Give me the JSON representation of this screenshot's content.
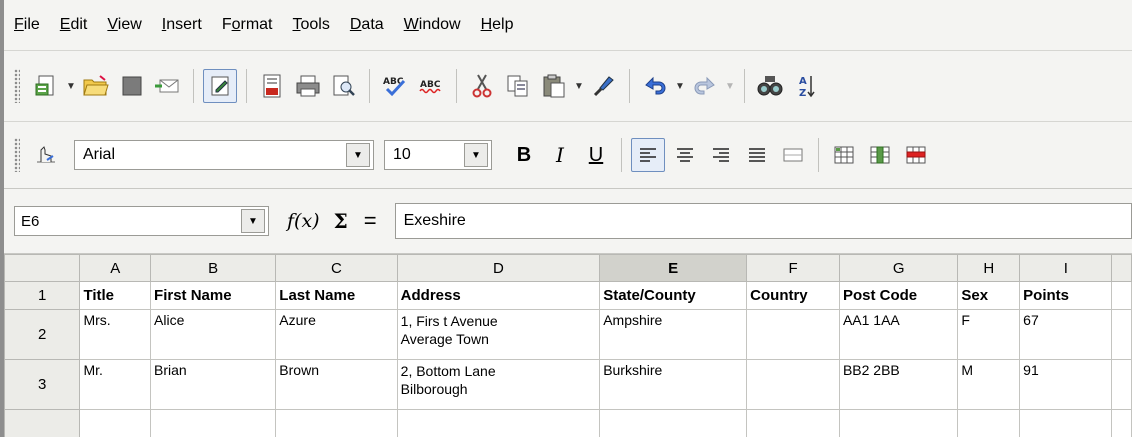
{
  "menu": [
    {
      "underline": "F",
      "rest": "ile"
    },
    {
      "underline": "E",
      "rest": "dit"
    },
    {
      "underline": "V",
      "rest": "iew"
    },
    {
      "underline": "I",
      "rest": "nsert"
    },
    {
      "pre": "F",
      "underline": "o",
      "rest": "rmat"
    },
    {
      "underline": "T",
      "rest": "ools"
    },
    {
      "underline": "D",
      "rest": "ata"
    },
    {
      "underline": "W",
      "rest": "indow"
    },
    {
      "underline": "H",
      "rest": "elp"
    }
  ],
  "format_bar": {
    "font_name": "Arial",
    "font_size": "10",
    "bold_label": "B",
    "italic_label": "I",
    "underline_label": "U"
  },
  "formula_bar": {
    "cell_ref": "E6",
    "fx_label": "f(x)",
    "sigma_label": "Σ",
    "equals_label": "=",
    "content": "Exeshire"
  },
  "sheet": {
    "columns": [
      "A",
      "B",
      "C",
      "D",
      "E",
      "F",
      "G",
      "H",
      "I"
    ],
    "active_column": "E",
    "rows": [
      {
        "num": "1",
        "cells": [
          "Title",
          "First Name",
          "Last Name",
          "Address",
          "State/County",
          "Country",
          "Post Code",
          "Sex",
          "Points"
        ]
      },
      {
        "num": "2",
        "cells": [
          "Mrs.",
          "Alice",
          "Azure",
          "1, Firs t Avenue\nAverage Town",
          "Ampshire",
          "",
          "AA1 1AA",
          "F",
          "67"
        ]
      },
      {
        "num": "3",
        "cells": [
          "Mr.",
          "Brian",
          "Brown",
          "2, Bottom Lane\nBilborough",
          "Burkshire",
          "",
          "BB2 2BB",
          "M",
          "91"
        ]
      },
      {
        "num": "",
        "cells": [
          "",
          "",
          "",
          "",
          "",
          "",
          "",
          "",
          ""
        ]
      }
    ]
  },
  "colors": {
    "header_bg": "#ecece8",
    "active_header_bg": "#d2d2cc",
    "toolbar_bg": "#f4f4f2"
  }
}
